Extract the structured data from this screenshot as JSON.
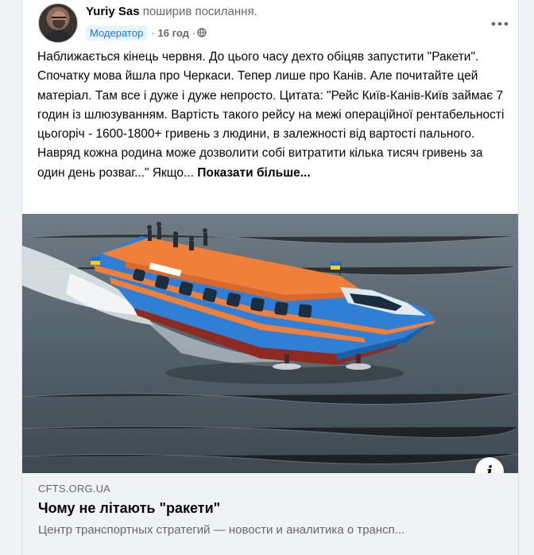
{
  "post": {
    "author": "Yuriy Sas",
    "action": "поширив посилання.",
    "badge": "Модератор",
    "time": "16 год",
    "separator": "·",
    "privacy_icon": "globe-icon",
    "more_icon": "more-horizontal-icon",
    "text": "Наближається кінець червня. До цього часу дехто обіцяв запустити \"Ракети\". Спочатку мова йшла про Черкаси. Тепер лише про Канів. Але почитайте цей матеріал. Там все і дуже і дуже непросто. Цитата: \"Рейс Київ-Канів-Київ займає 7 годин із шлюзуванням. Вартість такого рейсу на межі операційної рентабельності цьогоріч - 1600-1800+ гривень з людини, в залежності від вартості пального. Навряд кожна родина може дозволити собі витратити кілька тисяч гривень за один день розваг...\" Якщо...",
    "see_more": "Показати більше..."
  },
  "link": {
    "image_subject": "blue-orange hydrofoil boat on river",
    "info_icon": "info-icon",
    "info_glyph": "i",
    "domain": "CFTS.ORG.UA",
    "title": "Чому не літають \"ракети\"",
    "description": "Центр транспортных стратегий — новости и аналитика о трансп..."
  },
  "colors": {
    "accent": "#1877f2",
    "badge_bg": "#e7f3ff",
    "secondary_text": "#65676b",
    "link_meta_bg": "#f0f2f5",
    "boat_hull": "#2f7fd6",
    "boat_roof": "#f07f3a"
  }
}
